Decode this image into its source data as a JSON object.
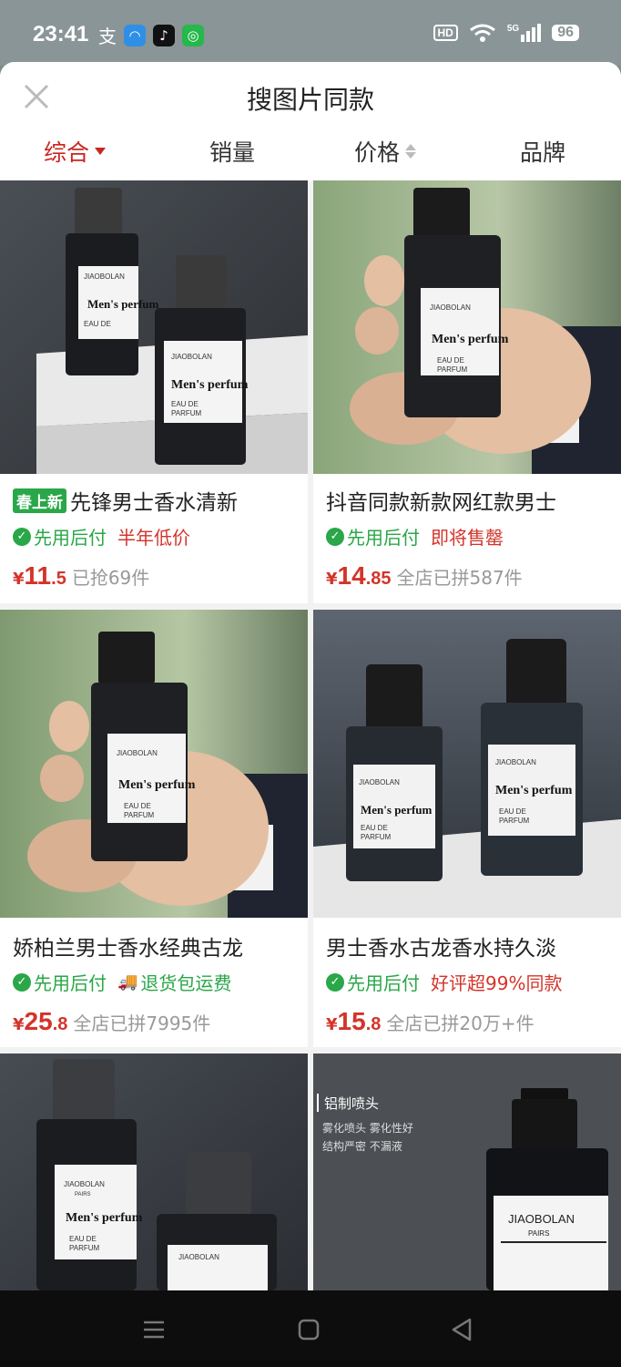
{
  "status_bar": {
    "time": "23:41",
    "hd": "HD",
    "network": "5G",
    "battery": "96"
  },
  "header": {
    "title": "搜图片同款"
  },
  "tabs": [
    "综合",
    "销量",
    "价格",
    "品牌"
  ],
  "products": [
    {
      "tag": "春上新",
      "name": "先锋男士香水清新",
      "benefits": [
        "先用后付"
      ],
      "promo": "半年低价",
      "price_int": "11",
      "price_dec": ".5",
      "sold": "已抢69件"
    },
    {
      "tag": "",
      "name": "抖音同款新款网红款男士",
      "benefits": [
        "先用后付"
      ],
      "promo": "即将售罄",
      "price_int": "14",
      "price_dec": ".85",
      "sold": "全店已拼587件"
    },
    {
      "tag": "",
      "name": "娇柏兰男士香水经典古龙",
      "benefits": [
        "先用后付",
        "退货包运费"
      ],
      "promo": "",
      "price_int": "25",
      "price_dec": ".8",
      "sold": "全店已拼7995件"
    },
    {
      "tag": "",
      "name": "男士香水古龙香水持久淡",
      "benefits": [
        "先用后付"
      ],
      "promo": "好评超99%同款",
      "price_int": "15",
      "price_dec": ".8",
      "sold": "全店已拼20万+件"
    }
  ],
  "image_text": {
    "brand": "JIAOBOLAN",
    "brand_sub": "PAIRS",
    "product_line": "Men's perfum",
    "eau1": "EAU DE",
    "eau2": "PARFUM",
    "ad_title": "铝制喷头",
    "ad_line1": "雾化喷头 雾化性好",
    "ad_line2": "结构严密 不漏液"
  },
  "currency": "¥",
  "colors": {
    "accent_red": "#c8261e",
    "price_red": "#d3342a",
    "green": "#2aa748"
  }
}
